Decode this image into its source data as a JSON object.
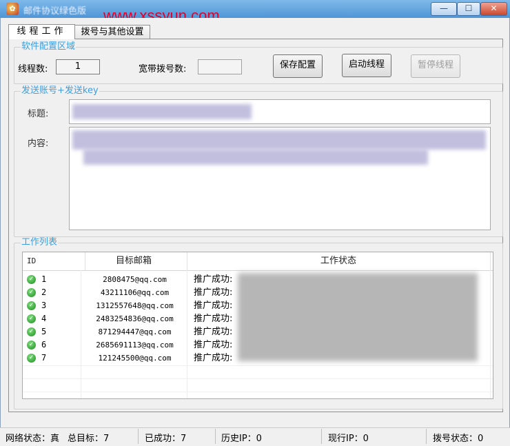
{
  "window": {
    "title": "邮件协议绿色版",
    "watermark": "www.xssyun.com",
    "minimize_glyph": "—",
    "maximize_glyph": "☐",
    "close_glyph": "✕",
    "app_icon": "app-logo-icon"
  },
  "tabs": [
    {
      "label": "线程工作",
      "active": true
    },
    {
      "label": "拨号与其他设置",
      "active": false
    }
  ],
  "config": {
    "legend": "软件配置区域",
    "threads_label": "线程数:",
    "threads_value": "1",
    "dial_label": "宽带拨号数:",
    "dial_value": "",
    "save_button": "保存配置",
    "start_button": "启动线程",
    "pause_button": "暂停线程"
  },
  "send": {
    "legend": "发送账号+发送key",
    "title_label": "标题:",
    "content_label": "内容:"
  },
  "work": {
    "legend": "工作列表",
    "columns": [
      "ID",
      "目标邮箱",
      "工作状态"
    ],
    "status_icon": "check-circle-icon",
    "rows": [
      {
        "id": "1",
        "email": "2808475@qq.com",
        "status": "推广成功:"
      },
      {
        "id": "2",
        "email": "43211106@qq.com",
        "status": "推广成功:"
      },
      {
        "id": "3",
        "email": "1312557648@qq.com",
        "status": "推广成功:"
      },
      {
        "id": "4",
        "email": "2483254836@qq.com",
        "status": "推广成功:"
      },
      {
        "id": "5",
        "email": "871294447@qq.com",
        "status": "推广成功:"
      },
      {
        "id": "6",
        "email": "2685691113@qq.com",
        "status": "推广成功:"
      },
      {
        "id": "7",
        "email": "121245500@qq.com",
        "status": "推广成功:"
      }
    ]
  },
  "statusbar": {
    "network": "网络状态：真",
    "total": "总目标：7",
    "success": "已成功：7",
    "history_ip": "历史IP：0",
    "current_ip": "现行IP：0",
    "dial_status": "拨号状态：0"
  }
}
